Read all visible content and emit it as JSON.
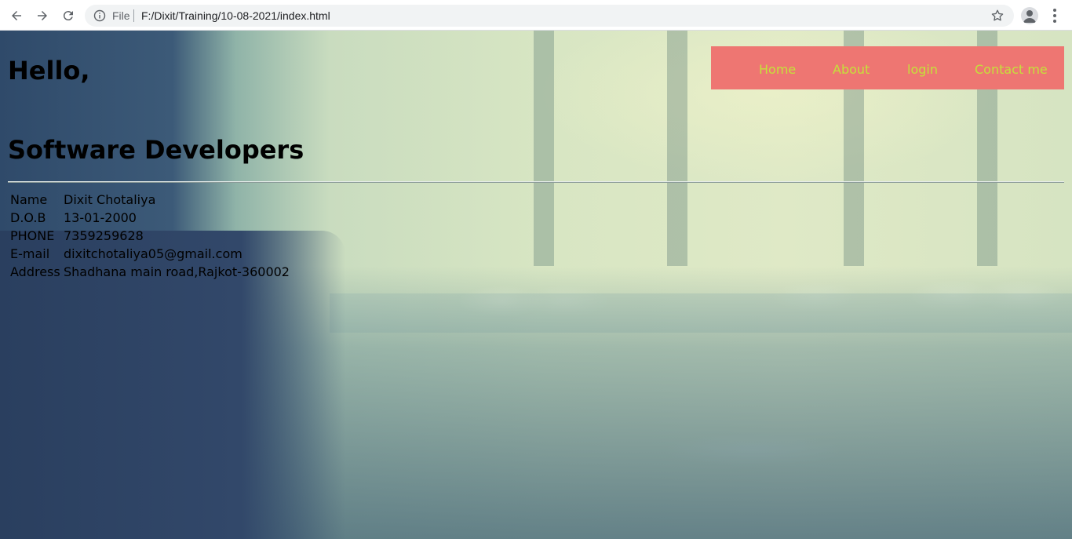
{
  "browser": {
    "file_label": "File",
    "url": "F:/Dixit/Training/10-08-2021/index.html"
  },
  "header": {
    "greeting": "Hello,",
    "role": "Software Developers"
  },
  "menu": {
    "items": [
      {
        "label": "Home"
      },
      {
        "label": "About"
      },
      {
        "label": "login"
      },
      {
        "label": "Contact me"
      }
    ]
  },
  "profile": {
    "rows": [
      {
        "key": "Name",
        "value": "Dixit Chotaliya"
      },
      {
        "key": "D.O.B",
        "value": "13-01-2000"
      },
      {
        "key": "PHONE",
        "value": "7359259628"
      },
      {
        "key": "E-mail",
        "value": "dixitchotaliya05@gmail.com"
      },
      {
        "key": "Address",
        "value": "Shadhana main road,Rajkot-360002"
      }
    ]
  },
  "colors": {
    "menu_bg": "#ee7672",
    "menu_text": "#c5e03a"
  }
}
